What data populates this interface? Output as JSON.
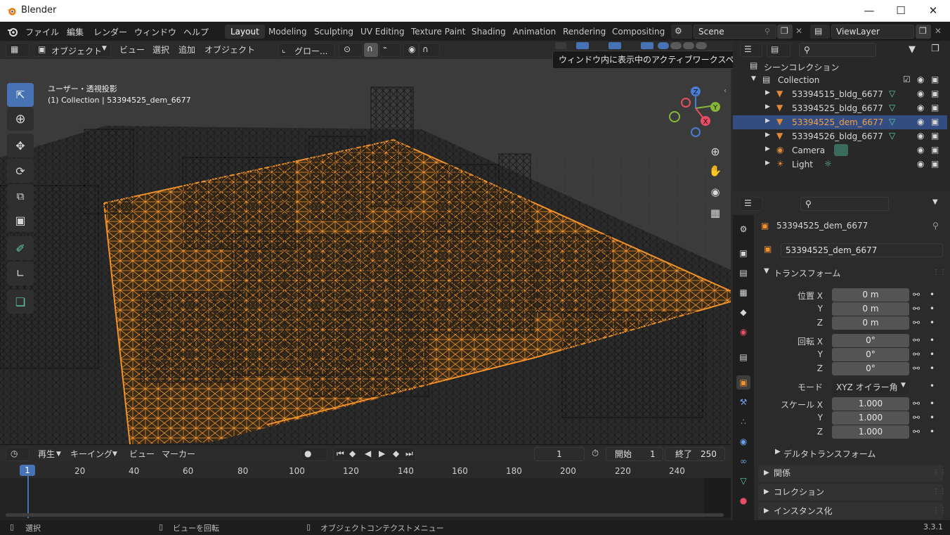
{
  "window": {
    "title": "Blender"
  },
  "menus": [
    "ファイル",
    "編集",
    "レンダー",
    "ウィンドウ",
    "ヘルプ"
  ],
  "workspaces": [
    "Layout",
    "Modeling",
    "Sculpting",
    "UV Editing",
    "Texture Paint",
    "Shading",
    "Animation",
    "Rendering",
    "Compositing"
  ],
  "active_workspace": "Layout",
  "scene": "Scene",
  "view_layer": "ViewLayer",
  "viewport_header": {
    "mode": "オブジェクト",
    "menus": [
      "ビュー",
      "選択",
      "追加",
      "オブジェクト"
    ],
    "orientation": "グロー..."
  },
  "tooltip": "ウィンドウ内に表示中のアクティブワークスペース.",
  "viewport": {
    "view_label": "ユーザー・透視投影",
    "context_label": "(1) Collection | 53394525_dem_6677",
    "wire_color": "#f0922c"
  },
  "gizmo": {
    "z": "Z",
    "y": "Y",
    "x": "X"
  },
  "outliner": {
    "root": "シーンコレクション",
    "collection": "Collection",
    "items": [
      {
        "name": "53394515_bldg_6677",
        "selected": false
      },
      {
        "name": "53394525_bldg_6677",
        "selected": false
      },
      {
        "name": "53394525_dem_6677",
        "selected": true
      },
      {
        "name": "53394526_bldg_6677",
        "selected": false
      },
      {
        "name": "Camera",
        "selected": false
      },
      {
        "name": "Light",
        "selected": false
      }
    ]
  },
  "properties": {
    "object_name": "53394525_dem_6677",
    "datablock": "53394525_dem_6677",
    "transform_title": "トランスフォーム",
    "location_label": "位置 X",
    "rotation_label": "回転 X",
    "scale_label": "スケール X",
    "y": "Y",
    "z": "Z",
    "location": [
      "0 m",
      "0 m",
      "0 m"
    ],
    "rotation": [
      "0°",
      "0°",
      "0°"
    ],
    "mode_label": "モード",
    "mode_value": "XYZ オイラー角",
    "scale": [
      "1.000",
      "1.000",
      "1.000"
    ],
    "delta": "デルタトランスフォーム",
    "panels": [
      "関係",
      "コレクション",
      "インスタンス化"
    ]
  },
  "timeline": {
    "menus": [
      "再生",
      "キーイング",
      "ビュー",
      "マーカー"
    ],
    "current_frame": "1",
    "start_label": "開始",
    "start": "1",
    "end_label": "終了",
    "end": "250",
    "ruler": [
      "1",
      "20",
      "40",
      "60",
      "80",
      "100",
      "120",
      "140",
      "160",
      "180",
      "200",
      "220",
      "240"
    ]
  },
  "status": {
    "select": "選択",
    "rotate": "ビューを回転",
    "context": "オブジェクトコンテクストメニュー",
    "version": "3.3.1"
  }
}
